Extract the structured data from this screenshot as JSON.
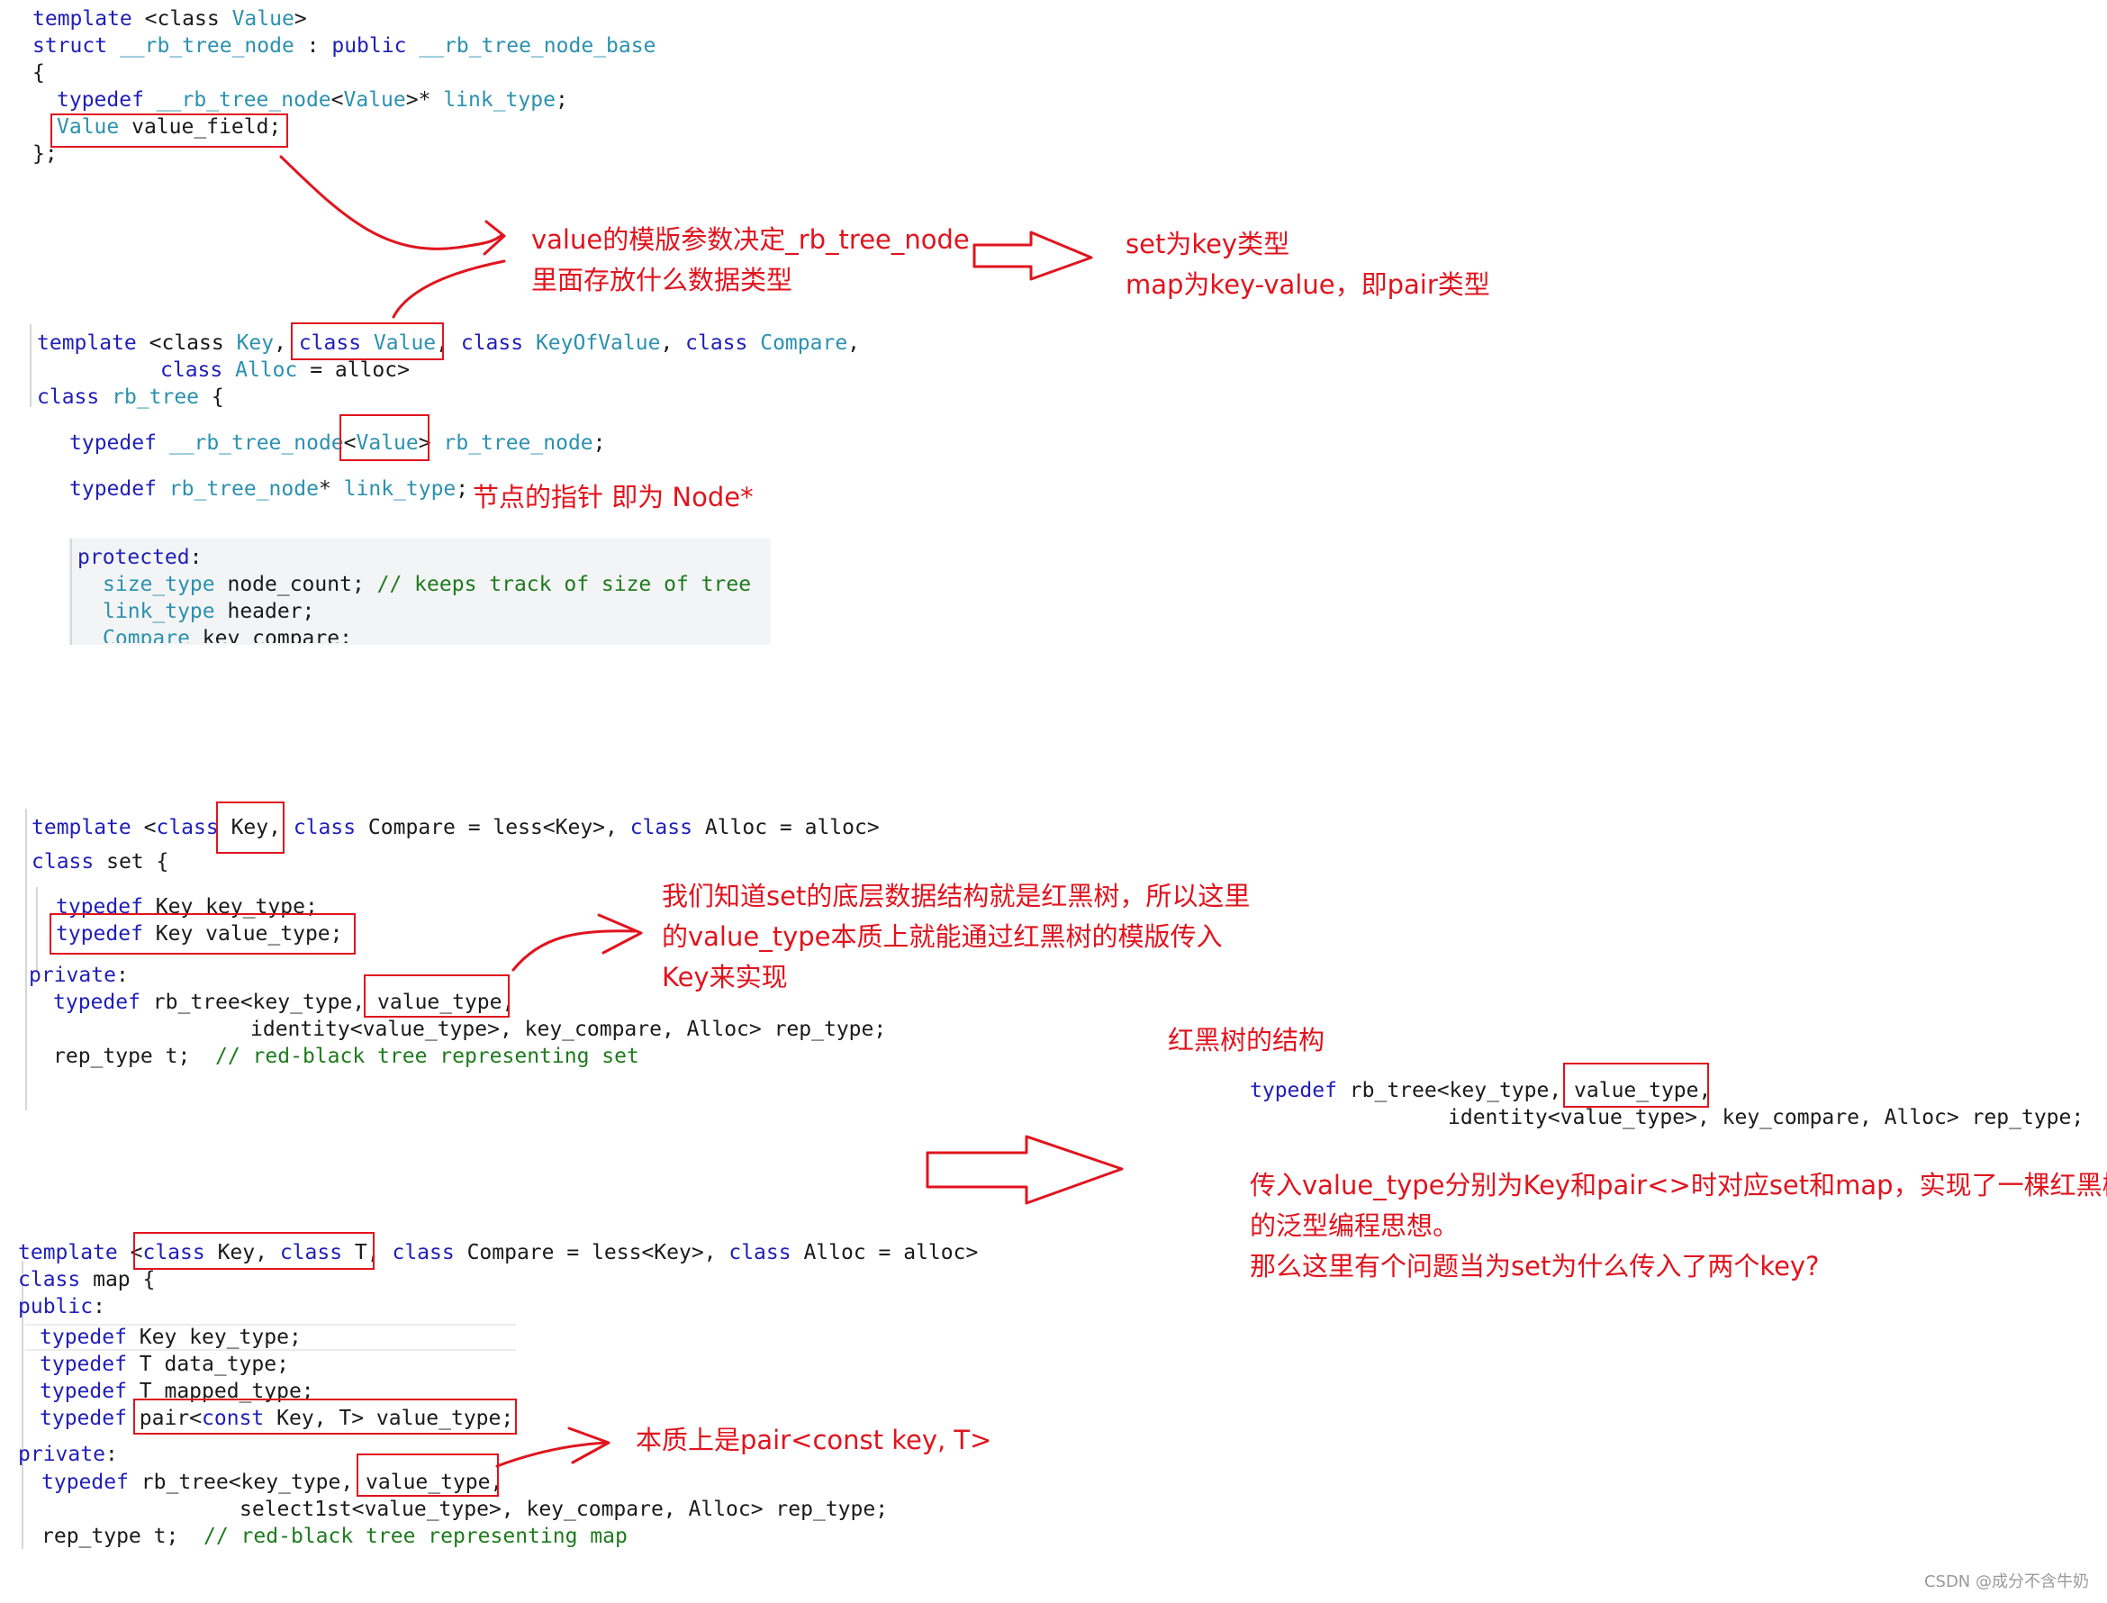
{
  "node_snippet": {
    "l1_kw": "template",
    "l1_rest": " <class ",
    "l1_ty": "Value",
    "l1_end": ">",
    "l2_kw1": "struct",
    "l2_ty1": " __rb_tree_node",
    "l2_sep": " : ",
    "l2_kw2": "public",
    "l2_ty2": " __rb_tree_node_base",
    "l3": "{",
    "l4_kw": "typedef",
    "l4_ty1": " __rb_tree_node",
    "l4_lt": "<",
    "l4_ty2": "Value",
    "l4_rest": ">* ",
    "l4_ty3": "link_type",
    "l4_end": ";",
    "l5_ty": "Value",
    "l5_rest": " value_field;",
    "l6": "};"
  },
  "rbtree_snippet": {
    "l1_kw": "template",
    "l1_a": " <class ",
    "l1_ty1": "Key",
    "l1_comma": ", ",
    "l1_kw2": "class",
    "l1_ty2": " Value",
    "l1_comma2": ", ",
    "l1_kw3": "class",
    "l1_ty3": " KeyOfValue",
    "l1_comma3": ", ",
    "l1_kw4": "class",
    "l1_ty4": " Compare",
    "l1_end": ",",
    "l2_kw": "class",
    "l2_ty": " Alloc",
    "l2_rest": " = alloc>",
    "l3_kw": "class",
    "l3_ty": " rb_tree",
    "l3_rest": " {",
    "l4_kw": "typedef",
    "l4_ty1": " __rb_tree_node",
    "l4_lt": "<",
    "l4_ty2": "Value",
    "l4_gt": "> ",
    "l4_ty3": "rb_tree_node",
    "l4_end": ";",
    "l5_kw": "typedef",
    "l5_ty1": " rb_tree_node",
    "l5_star": "* ",
    "l5_ty2": "link_type",
    "l5_end": ";",
    "l6_kw": "protected",
    "l6_end": ":",
    "l7_ty": "size_type",
    "l7_rest": " node_count; ",
    "l7_cm": "// keeps track of size of tree",
    "l8_ty": "link_type",
    "l8_rest": " header;",
    "l9_ty": "Compare",
    "l9_rest": " key_compare;"
  },
  "set_snippet": {
    "l1_kw": "template",
    "l1_a": " <",
    "l1_kw2": "class",
    "l1_b": " Key, ",
    "l1_kw3": "class",
    "l1_c": " Compare = less<Key>, ",
    "l1_kw4": "class",
    "l1_d": " Alloc = alloc>",
    "l2_kw": "class",
    "l2_rest": " set {",
    "l3_kw": "typedef",
    "l3_rest": " Key key_type;",
    "l4_kw": "typedef",
    "l4_rest": " Key value_type;",
    "l5_kw": "private",
    "l5_end": ":",
    "l6_kw": "typedef",
    "l6_rest": " rb_tree<key_type, value_type,",
    "l7": "identity<value_type>, key_compare, Alloc> rep_type;",
    "l8_a": "rep_type t;  ",
    "l8_cm": "// red-black tree representing set"
  },
  "map_snippet": {
    "l1_kw": "template",
    "l1_a": " <",
    "l1_kw2": "class",
    "l1_b": " Key, ",
    "l1_kw3": "class",
    "l1_c": " T, ",
    "l1_kw4": "class",
    "l1_d": " Compare = less<Key>, ",
    "l1_kw5": "class",
    "l1_e": " Alloc = alloc>",
    "l2_kw": "class",
    "l2_rest": " map {",
    "l3_kw": "public",
    "l3_end": ":",
    "l4_kw": "typedef",
    "l4_rest": " Key key_type;",
    "l5_kw": "typedef",
    "l5_rest": " T data_type;",
    "l6_kw": "typedef",
    "l6_rest": " T mapped_type;",
    "l7_kw": "typedef",
    "l7_a": " pair<",
    "l7_kw2": "const",
    "l7_b": " Key, T> value_type;",
    "l8_kw": "private",
    "l8_end": ":",
    "l9_kw": "typedef",
    "l9_rest": " rb_tree<key_type, value_type,",
    "l10": "select1st<value_type>, key_compare, Alloc> rep_type;",
    "l11_a": "rep_type t;  ",
    "l11_cm": "// red-black tree representing map"
  },
  "rb_structure": {
    "l1_kw": "typedef",
    "l1_rest": " rb_tree<key_type, value_type,",
    "l2": "identity<value_type>, key_compare, Alloc> rep_type;"
  },
  "notes": {
    "value_param_1": "value的模版参数决定_rb_tree_node",
    "value_param_2": "里面存放什么数据类型",
    "set_type": "set为key类型",
    "map_type": "map为key-value，即pair类型",
    "node_ptr": "节点的指针 即为 Node*",
    "set_explain_1": "我们知道set的底层数据结构就是红黑树，所以这里",
    "set_explain_2": "的value_type本质上就能通过红黑树的模版传入",
    "set_explain_3": "Key来实现",
    "rb_structure_title": "红黑树的结构",
    "conclusion_1": "传入value_type分别为Key和pair<>时对应set和map，实现了一棵红黑树",
    "conclusion_2": "的泛型编程思想。",
    "conclusion_3": "那么这里有个问题当为set为什么传入了两个key?",
    "pair_note": "本质上是pair<const key, T>"
  },
  "watermark": "CSDN @成分不含牛奶",
  "colors": {
    "annotation": "#e0141e",
    "keyword": "#1f1fb8",
    "type": "#2b91af",
    "comment": "#1d7a1d"
  }
}
